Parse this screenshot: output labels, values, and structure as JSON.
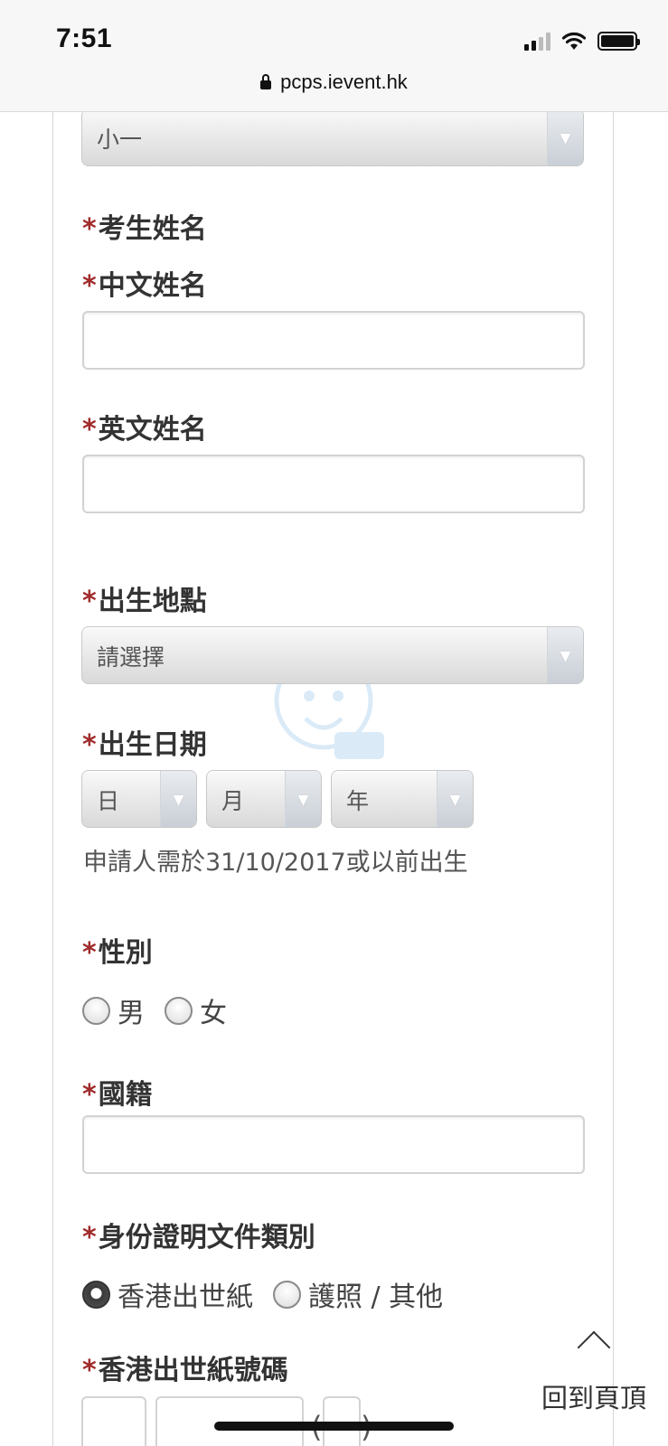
{
  "status_bar": {
    "time": "7:51"
  },
  "browser": {
    "url": "pcps.ievent.hk"
  },
  "form": {
    "grade_select": {
      "value": "小一"
    },
    "candidate_name_heading": "考生姓名",
    "chinese_name": {
      "label": "中文姓名",
      "value": ""
    },
    "english_name": {
      "label": "英文姓名",
      "value": ""
    },
    "birth_place": {
      "label": "出生地點",
      "value": "請選擇"
    },
    "birth_date": {
      "label": "出生日期",
      "day": "日",
      "month": "月",
      "year": "年",
      "hint": "申請人需於31/10/2017或以前出生"
    },
    "gender": {
      "label": "性別",
      "options": [
        "男",
        "女"
      ],
      "selected": null
    },
    "nationality": {
      "label": "國籍",
      "value": ""
    },
    "id_doc_type": {
      "label": "身份證明文件類別",
      "options": [
        "香港出世紙",
        "護照 / 其他"
      ],
      "selected": "香港出世紙"
    },
    "hk_birth_cert_no": {
      "label": "香港出世紙號碼",
      "open_paren": "(",
      "close_paren": ")"
    },
    "required_mark": "*"
  },
  "back_to_top": {
    "label": "回到頁頂"
  },
  "colors": {
    "required": "#a12b2b",
    "panel_border": "#d6d6d6"
  }
}
